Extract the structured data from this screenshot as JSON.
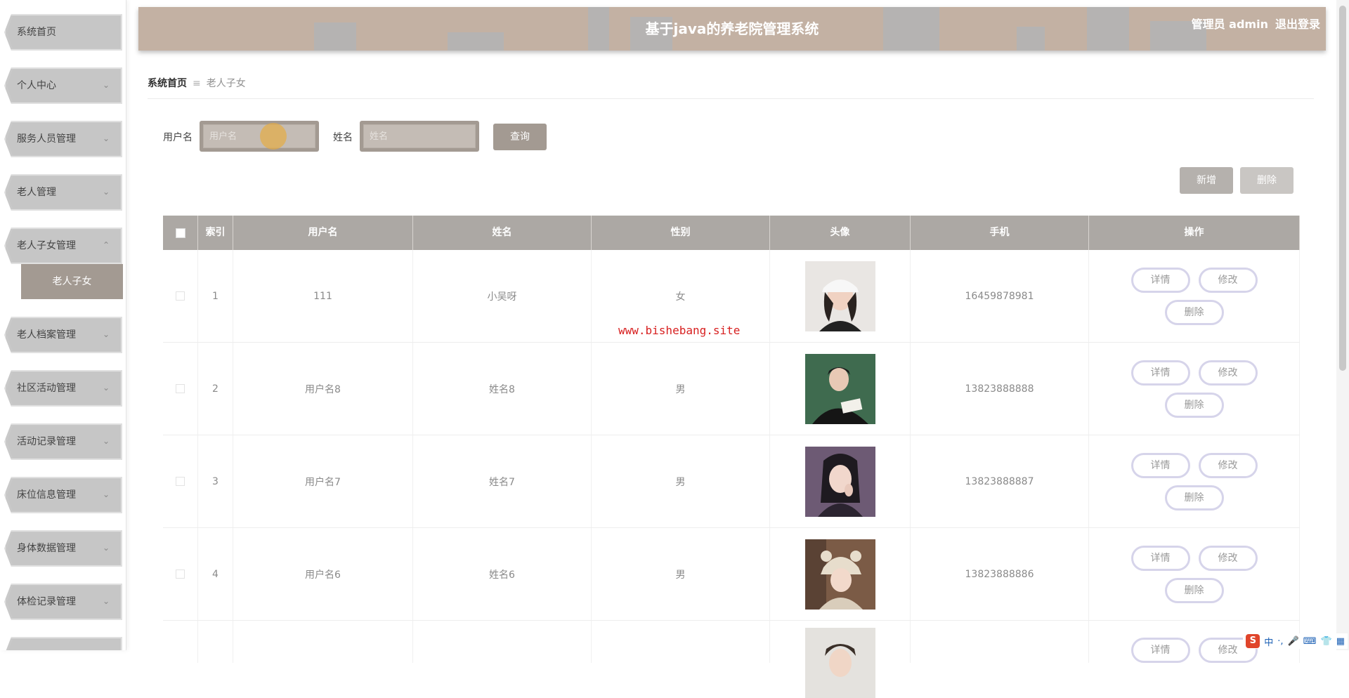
{
  "sidebar": {
    "items": [
      {
        "label": "系统首页",
        "chevron": ""
      },
      {
        "label": "个人中心",
        "chevron": "⌄"
      },
      {
        "label": "服务人员管理",
        "chevron": "⌄"
      },
      {
        "label": "老人管理",
        "chevron": "⌄"
      },
      {
        "label": "老人子女管理",
        "chevron": "⌃"
      },
      {
        "label": "老人档案管理",
        "chevron": "⌄"
      },
      {
        "label": "社区活动管理",
        "chevron": "⌄"
      },
      {
        "label": "活动记录管理",
        "chevron": "⌄"
      },
      {
        "label": "床位信息管理",
        "chevron": "⌄"
      },
      {
        "label": "身体数据管理",
        "chevron": "⌄"
      },
      {
        "label": "体检记录管理",
        "chevron": "⌄"
      }
    ],
    "submenu_label": "老人子女"
  },
  "header": {
    "title": "基于java的养老院管理系统",
    "user_label": "管理员 admin",
    "logout_label": "退出登录"
  },
  "breadcrumb": {
    "home": "系统首页",
    "separator": "≡",
    "current": "老人子女"
  },
  "search": {
    "username_label": "用户名",
    "username_placeholder": "用户名",
    "name_label": "姓名",
    "name_placeholder": "姓名",
    "query_label": "查询"
  },
  "actions": {
    "add_label": "新增",
    "delete_label": "删除"
  },
  "table": {
    "headers": [
      "索引",
      "用户名",
      "姓名",
      "性别",
      "头像",
      "手机",
      "操作"
    ],
    "rows": [
      {
        "index": "1",
        "username": "111",
        "name": "小吴呀",
        "gender": "女",
        "phone": "16459878981"
      },
      {
        "index": "2",
        "username": "用户名8",
        "name": "姓名8",
        "gender": "男",
        "phone": "13823888888"
      },
      {
        "index": "3",
        "username": "用户名7",
        "name": "姓名7",
        "gender": "男",
        "phone": "13823888887"
      },
      {
        "index": "4",
        "username": "用户名6",
        "name": "姓名6",
        "gender": "男",
        "phone": "13823888886"
      }
    ],
    "op_detail": "详情",
    "op_edit": "修改",
    "op_delete": "删除"
  },
  "watermark": "www.bishebang.site",
  "colors": {
    "accent": "#a39a92",
    "header_bg": "#c3b1a3",
    "table_header": "#aca8a4",
    "watermark": "#d71f1f"
  },
  "ime": {
    "logo": "S",
    "lang": "中"
  }
}
